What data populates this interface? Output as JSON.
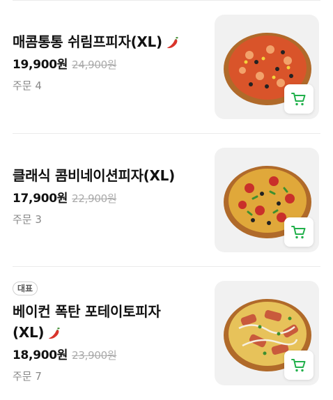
{
  "menu": [
    {
      "name": "매콤통통 쉬림프피자(XL)",
      "spicy": true,
      "badge": "",
      "price": "19,900원",
      "original_price": "24,900원",
      "orders_label": "주문 4"
    },
    {
      "name": "클래식 콤비네이션피자(XL)",
      "spicy": false,
      "badge": "",
      "price": "17,900원",
      "original_price": "22,900원",
      "orders_label": "주문 3"
    },
    {
      "name": "베이컨 폭탄 포테이토피자",
      "name_line2": "(XL)",
      "spicy": true,
      "badge": "대표",
      "price": "18,900원",
      "original_price": "23,900원",
      "orders_label": "주문 7"
    }
  ],
  "icons": {
    "spicy": "chili-pepper-icon",
    "cart": "shopping-cart-icon"
  },
  "colors": {
    "accent_green": "#21b04b",
    "pepper_red": "#d9342b"
  }
}
